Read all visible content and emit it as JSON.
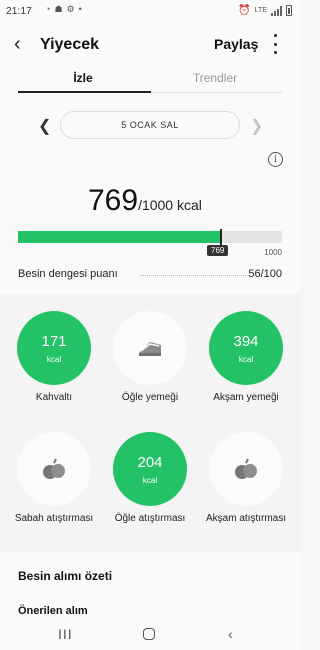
{
  "status_bar": {
    "time": "21:17",
    "notification_icons": [
      "snooze-icon",
      "android-icon",
      "settings-icon",
      "dot-icon"
    ],
    "right_icons": [
      "alarm-icon",
      "wifi-lte-icon",
      "signal-icon",
      "battery-icon"
    ],
    "network_label": "LTE"
  },
  "header": {
    "title": "Yiyecek",
    "share_label": "Paylaş"
  },
  "tabs": [
    {
      "label": "İzle",
      "active": true
    },
    {
      "label": "Trendler",
      "active": false
    }
  ],
  "date": {
    "label": "5 OCAK SAL"
  },
  "calories": {
    "consumed": "769",
    "goal_text": "/1000 kcal",
    "progress_fraction": 0.769,
    "marker_label": "769",
    "goal_label": "1000"
  },
  "balance": {
    "label": "Besin dengesi puanı",
    "value": "56/100"
  },
  "meals": [
    {
      "label": "Kahvaltı",
      "value": "171",
      "unit": "kcal",
      "filled": true,
      "icon": null
    },
    {
      "label": "Öğle yemeği",
      "value": null,
      "unit": null,
      "filled": false,
      "icon": "sandwich-icon"
    },
    {
      "label": "Akşam yemeği",
      "value": "394",
      "unit": "kcal",
      "filled": true,
      "icon": null
    },
    {
      "label": "Sabah atıştırması",
      "value": null,
      "unit": null,
      "filled": false,
      "icon": "fruit-icon"
    },
    {
      "label": "Öğle atıştırması",
      "value": "204",
      "unit": "kcal",
      "filled": true,
      "icon": null
    },
    {
      "label": "Akşam atıştırması",
      "value": null,
      "unit": null,
      "filled": false,
      "icon": "fruit-icon"
    }
  ],
  "summary": {
    "intake_summary": "Besin alımı özeti",
    "recommended": "Önerilen alım"
  },
  "colors": {
    "accent_green": "#23c266",
    "marker_dark": "#333333"
  }
}
